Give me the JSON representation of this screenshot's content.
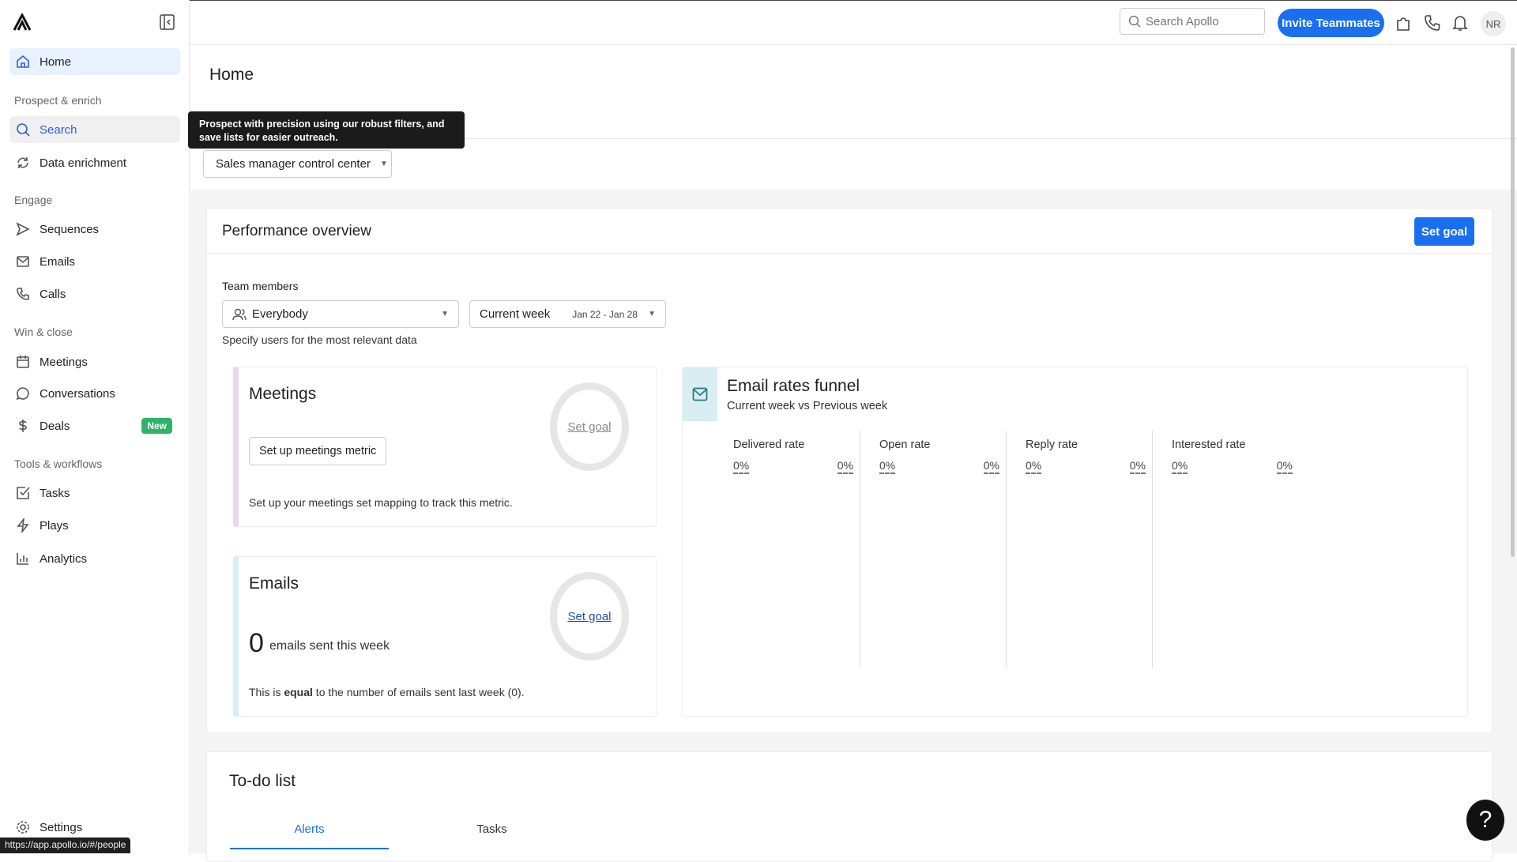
{
  "sidebar": {
    "home": "Home",
    "sections": [
      "Prospect & enrich",
      "Engage",
      "Win & close",
      "Tools & workflows"
    ],
    "items": {
      "search": "Search",
      "data_enrichment": "Data enrichment",
      "sequences": "Sequences",
      "emails": "Emails",
      "calls": "Calls",
      "meetings": "Meetings",
      "conversations": "Conversations",
      "deals": "Deals",
      "deals_badge": "New",
      "tasks": "Tasks",
      "plays": "Plays",
      "analytics": "Analytics",
      "settings": "Settings"
    }
  },
  "topbar": {
    "search_placeholder": "Search Apollo",
    "invite": "Invite Teammates",
    "avatar": "NR"
  },
  "page": {
    "title": "Home",
    "tooltip": "Prospect with precision using our robust filters, and save lists for easier outreach.",
    "dashboard_select": "Sales manager control center"
  },
  "performance": {
    "title": "Performance overview",
    "set_goal": "Set goal",
    "team_label": "Team members",
    "team_value": "Everybody",
    "period": "Current week",
    "period_range": "Jan 22 - Jan 28",
    "hint": "Specify users for the most relevant data",
    "meetings": {
      "title": "Meetings",
      "button": "Set up meetings metric",
      "goal": "Set goal",
      "note": "Set up your meetings set mapping to track this metric."
    },
    "emails": {
      "title": "Emails",
      "count": "0",
      "count_label": "emails sent this week",
      "goal": "Set goal",
      "note_a": "This is ",
      "note_b": "equal",
      "note_c": " to the number of emails sent last week (0)."
    },
    "funnel": {
      "title": "Email rates funnel",
      "subtitle": "Current week vs Previous week",
      "columns": [
        {
          "label": "Delivered rate",
          "current": "0%",
          "previous": "0%"
        },
        {
          "label": "Open rate",
          "current": "0%",
          "previous": "0%"
        },
        {
          "label": "Reply rate",
          "current": "0%",
          "previous": "0%"
        },
        {
          "label": "Interested rate",
          "current": "0%",
          "previous": "0%"
        }
      ]
    }
  },
  "todo": {
    "title": "To-do list",
    "tabs": [
      "Alerts",
      "Tasks"
    ]
  },
  "status_url": "https://app.apollo.io/#/people",
  "colors": {
    "accent": "#1a6ff0",
    "meetings_bar": "#ecd5ef",
    "emails_bar": "#d6eff3"
  }
}
